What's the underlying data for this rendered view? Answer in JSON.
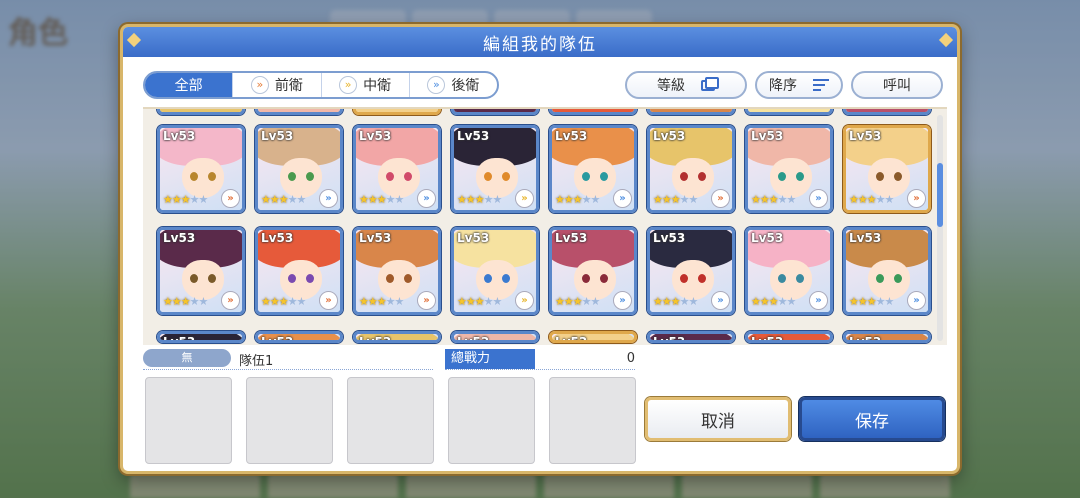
{
  "background": {
    "title": "角色"
  },
  "dialog": {
    "title": "編組我的隊伍",
    "filters": {
      "tabs": [
        {
          "label": "全部",
          "active": true,
          "icon": ""
        },
        {
          "label": "前衛",
          "active": false,
          "icon": "front-role-icon"
        },
        {
          "label": "中衛",
          "active": false,
          "icon": "middle-role-icon"
        },
        {
          "label": "後衛",
          "active": false,
          "icon": "back-role-icon"
        }
      ],
      "level_label": "等級",
      "order_label": "降序",
      "call_label": "呼叫"
    },
    "roster": [
      {
        "level": "Lv53",
        "stars": 3,
        "hair": "#f4b7c9",
        "eyes": "#b8862e",
        "frame": "blue",
        "role": "front"
      },
      {
        "level": "Lv53",
        "stars": 3,
        "hair": "#d8b28c",
        "eyes": "#4a9a4e",
        "frame": "blue",
        "role": "back"
      },
      {
        "level": "Lv53",
        "stars": 3,
        "hair": "#f2a6a6",
        "eyes": "#d14a6a",
        "frame": "blue",
        "role": "back"
      },
      {
        "level": "Lv53",
        "stars": 3,
        "hair": "#2a2436",
        "eyes": "#e08a2a",
        "frame": "blue",
        "role": "middle"
      },
      {
        "level": "Lv53",
        "stars": 3,
        "hair": "#e9904a",
        "eyes": "#2a9aa0",
        "frame": "blue",
        "role": "back"
      },
      {
        "level": "Lv53",
        "stars": 3,
        "hair": "#e7c46a",
        "eyes": "#b23030",
        "frame": "blue",
        "role": "front"
      },
      {
        "level": "Lv53",
        "stars": 3,
        "hair": "#f0b7a8",
        "eyes": "#2a9a8a",
        "frame": "blue",
        "role": "back"
      },
      {
        "level": "Lv53",
        "stars": 3,
        "hair": "#f3d08a",
        "eyes": "#8a5a2a",
        "frame": "gold",
        "role": "front"
      },
      {
        "level": "Lv53",
        "stars": 3,
        "hair": "#5a2a4a",
        "eyes": "#7a5a2a",
        "frame": "blue",
        "role": "front"
      },
      {
        "level": "Lv53",
        "stars": 3,
        "hair": "#e65a3a",
        "eyes": "#7a4ab0",
        "frame": "blue",
        "role": "front"
      },
      {
        "level": "Lv53",
        "stars": 3,
        "hair": "#d9864a",
        "eyes": "#a05a2a",
        "frame": "blue",
        "role": "front"
      },
      {
        "level": "Lv53",
        "stars": 3,
        "hair": "#f6e2a0",
        "eyes": "#3a7ad0",
        "frame": "blue",
        "role": "middle"
      },
      {
        "level": "Lv53",
        "stars": 3,
        "hair": "#b8506a",
        "eyes": "#8a2a3a",
        "frame": "blue",
        "role": "back"
      },
      {
        "level": "Lv53",
        "stars": 3,
        "hair": "#2a2a40",
        "eyes": "#c0302a",
        "frame": "blue",
        "role": "back"
      },
      {
        "level": "Lv53",
        "stars": 3,
        "hair": "#f6b2c6",
        "eyes": "#3a8aa0",
        "frame": "blue",
        "role": "back"
      },
      {
        "level": "Lv53",
        "stars": 3,
        "hair": "#c98a4a",
        "eyes": "#3a9a5a",
        "frame": "blue",
        "role": "back"
      }
    ],
    "team": {
      "tag": "無",
      "name": "隊伍1",
      "power_label": "總戰力",
      "power_value": "0"
    },
    "buttons": {
      "cancel": "取消",
      "save": "保存"
    }
  }
}
